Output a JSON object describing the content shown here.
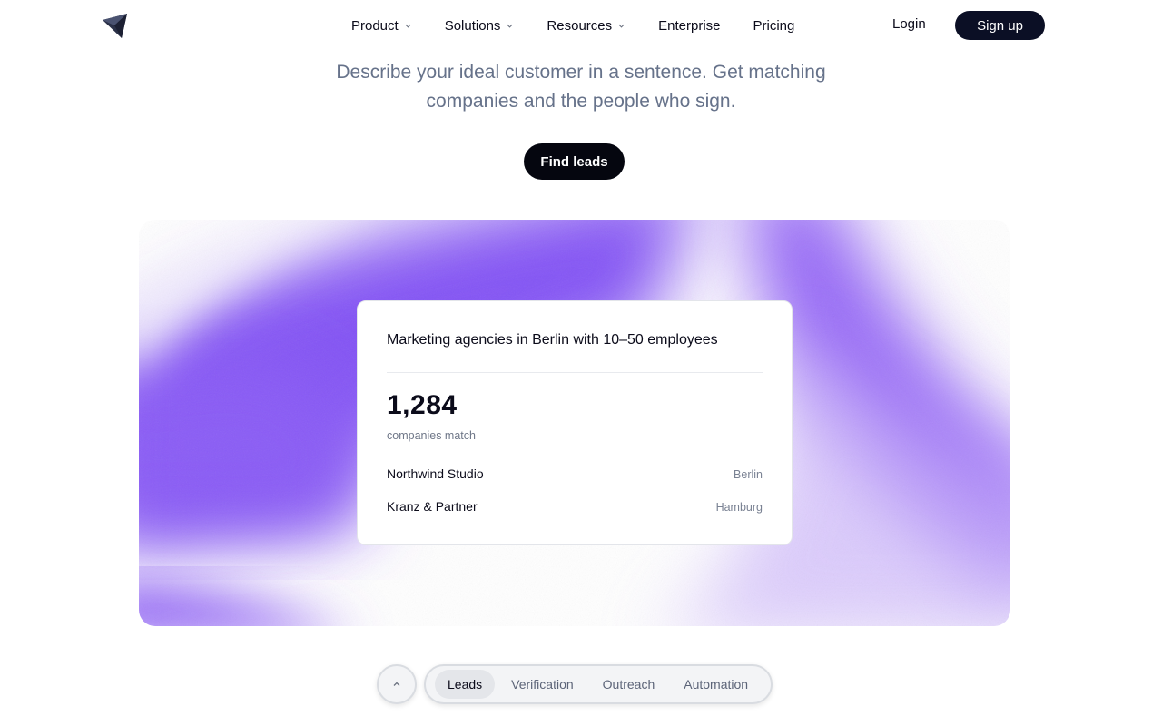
{
  "header": {
    "logo_icon": "paper-plane-arrow-icon",
    "nav": [
      {
        "label": "Product",
        "has_dropdown": true
      },
      {
        "label": "Solutions",
        "has_dropdown": true
      },
      {
        "label": "Resources",
        "has_dropdown": true
      },
      {
        "label": "Enterprise",
        "has_dropdown": false
      },
      {
        "label": "Pricing",
        "has_dropdown": false
      }
    ],
    "login_label": "Login",
    "signup_label": "Sign up"
  },
  "hero": {
    "subtitle": "Describe your ideal customer in a sentence. Get matching companies and the people who sign.",
    "cta_label": "Find leads"
  },
  "demo_card": {
    "query": "Marketing agencies in Berlin with 10–50 employees",
    "count": "1,284",
    "count_label": "companies match",
    "results": [
      {
        "name": "Northwind Studio",
        "city": "Berlin"
      },
      {
        "name": "Kranz & Partner",
        "city": "Hamburg"
      }
    ]
  },
  "tabbar": {
    "scroll_top_icon": "chevron-up-icon",
    "tabs": [
      {
        "label": "Leads",
        "active": true
      },
      {
        "label": "Verification",
        "active": false
      },
      {
        "label": "Outreach",
        "active": false
      },
      {
        "label": "Automation",
        "active": false
      }
    ]
  },
  "colors": {
    "accent_purple": "#8b5cf6",
    "button_dark": "#0b0f25",
    "subtitle_gray": "#66728a"
  }
}
